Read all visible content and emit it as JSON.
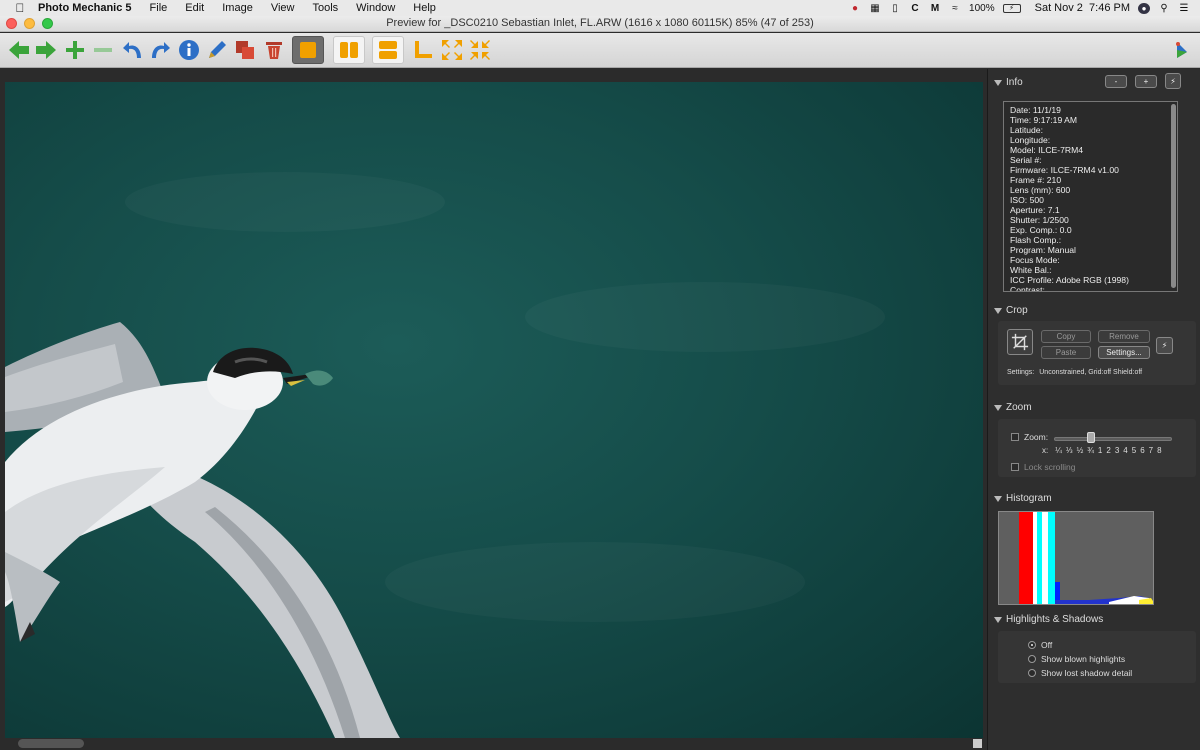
{
  "menubar": {
    "app_name": "Photo Mechanic 5",
    "items": [
      "File",
      "Edit",
      "Image",
      "View",
      "Tools",
      "Window",
      "Help"
    ],
    "battery": "100%",
    "datetime": "Sat Nov 2  7:46 PM"
  },
  "window": {
    "title": "Preview for _DSC0210 Sebastian Inlet, FL.ARW (1616 x 1080 60115K) 85% (47 of 253)"
  },
  "toolbar": {
    "buttons": [
      "back-arrow",
      "forward-arrow",
      "add",
      "remove",
      "rotate-left",
      "rotate-right",
      "info",
      "edit-pencil",
      "copy-stack",
      "trash",
      "single-view",
      "side-by-side",
      "stacked",
      "crop",
      "expand",
      "compress"
    ]
  },
  "panel": {
    "info": {
      "title": "Info",
      "btn_minus": "-",
      "btn_plus": "+",
      "lines": [
        "Date: 11/1/19",
        "Time: 9:17:19 AM",
        "Latitude:",
        "Longitude:",
        "Model: ILCE-7RM4",
        "Serial #:",
        "Firmware: ILCE-7RM4 v1.00",
        "Frame #: 210",
        "Lens (mm): 600",
        "ISO: 500",
        "Aperture: 7.1",
        "Shutter: 1/2500",
        "Exp. Comp.: 0.0",
        "Flash Comp.:",
        "Program: Manual",
        "Focus Mode:",
        "White Bal.:",
        "ICC Profile: Adobe RGB (1998)",
        "Contrast:"
      ]
    },
    "crop": {
      "title": "Crop",
      "copy": "Copy",
      "remove": "Remove",
      "paste": "Paste",
      "settings_btn": "Settings...",
      "settings_label": "Settings:",
      "settings_value": "Unconstrained, Grid:off Shield:off"
    },
    "zoom": {
      "title": "Zoom",
      "zoom_label": "Zoom:",
      "x_label": "x:",
      "scale": [
        "¼",
        "⅓",
        "½",
        "¾",
        "1",
        "2",
        "3",
        "4",
        "5",
        "6",
        "7",
        "8"
      ],
      "lock_scrolling": "Lock scrolling"
    },
    "histogram": {
      "title": "Histogram"
    },
    "highlights": {
      "title": "Highlights & Shadows",
      "options": [
        "Off",
        "Show blown highlights",
        "Show lost shadow detail"
      ],
      "selected": 0
    }
  }
}
